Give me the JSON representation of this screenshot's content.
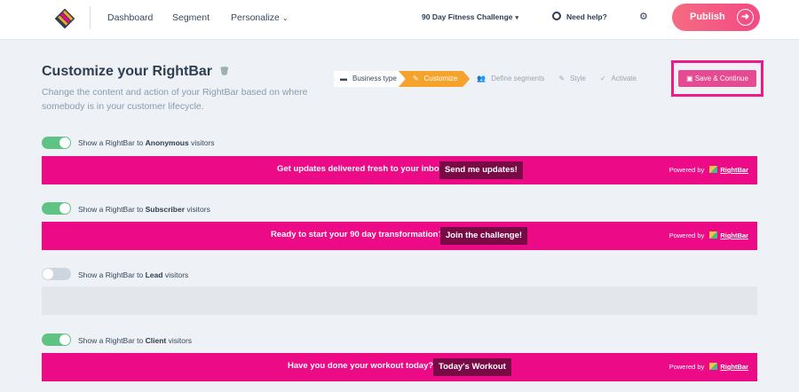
{
  "nav": {
    "links": [
      "Dashboard",
      "Segment",
      "Personalize"
    ],
    "project": "90 Day Fitness Challenge",
    "help": "Need help?",
    "publish": "Publish"
  },
  "header": {
    "title": "Customize your RightBar",
    "subtitle": "Change the content and action of your RightBar based on where somebody is in your customer lifecycle."
  },
  "stepper": {
    "steps": [
      "Business type",
      "Customize",
      "Define segments",
      "Style",
      "Activate"
    ],
    "active_index": 1
  },
  "save_button": "Save & Continue",
  "segments": [
    {
      "prefix": "Show a RightBar to",
      "segment": "Anonymous",
      "suffix": "visitors",
      "enabled": true,
      "message": "Get updates delivered fresh to your inbox",
      "cta": "Send me updates!"
    },
    {
      "prefix": "Show a RightBar to",
      "segment": "Subscriber",
      "suffix": "visitors",
      "enabled": true,
      "message": "Ready to start your 90 day transformation?",
      "cta": "Join the challenge!"
    },
    {
      "prefix": "Show a RightBar to",
      "segment": "Lead",
      "suffix": "visitors",
      "enabled": false
    },
    {
      "prefix": "Show a RightBar to",
      "segment": "Client",
      "suffix": "visitors",
      "enabled": true,
      "message": "Have you done your workout today?",
      "cta": "Today's Workout"
    }
  ],
  "powered_by": {
    "label": "Powered by",
    "brand": "RightBar"
  },
  "colors": {
    "accent": "#ec0a86",
    "toggle_on": "#5fc383",
    "step_active": "#f6a32d",
    "cta_bg": "#7a0a45"
  }
}
